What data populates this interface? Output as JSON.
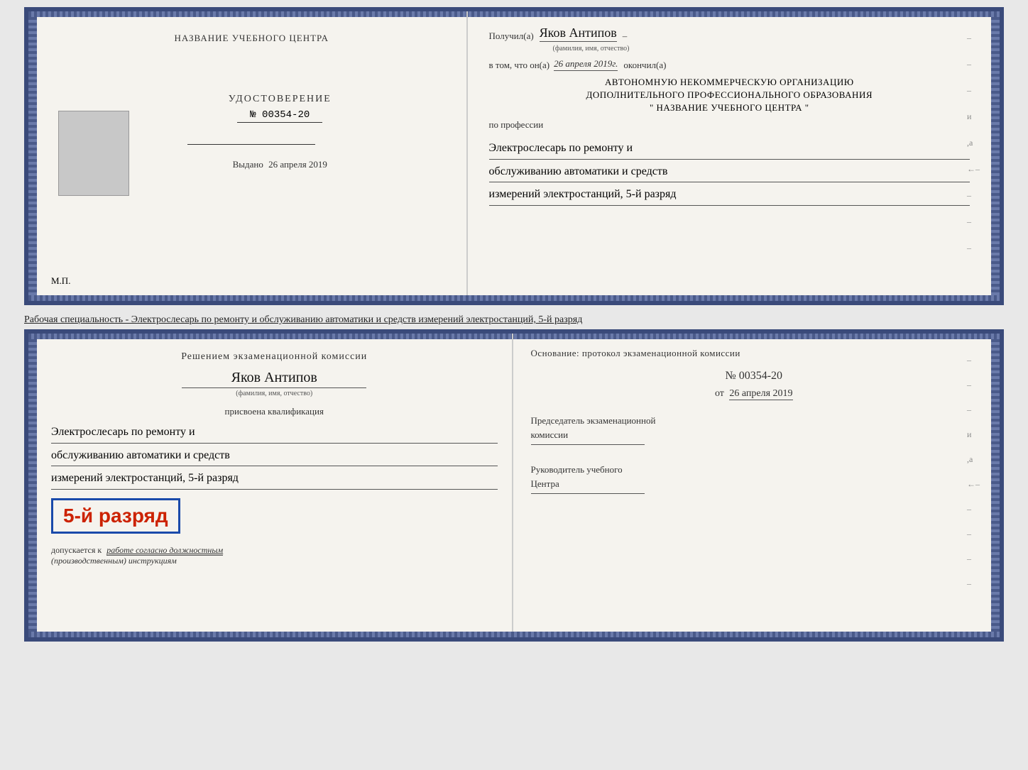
{
  "top_book": {
    "left_page": {
      "training_center_label": "НАЗВАНИЕ УЧЕБНОГО ЦЕНТРА",
      "doc_title": "УДОСТОВЕРЕНИЕ",
      "doc_number": "№ 00354-20",
      "vydano_label": "Выдано",
      "vydano_date": "26 апреля 2019",
      "mp_label": "М.П."
    },
    "right_page": {
      "poluchil_label": "Получил(а)",
      "recipient_name": "Яков Антипов",
      "fio_label": "(фамилия, имя, отчество)",
      "vtom_label": "в том, что он(а)",
      "date_text": "26 апреля 2019г.",
      "okonchil_label": "окончил(а)",
      "org_line1": "АВТОНОМНУЮ НЕКОММЕРЧЕСКУЮ ОРГАНИЗАЦИЮ",
      "org_line2": "ДОПОЛНИТЕЛЬНОГО ПРОФЕССИОНАЛЬНОГО ОБРАЗОВАНИЯ",
      "org_quote": "\"  НАЗВАНИЕ УЧЕБНОГО ЦЕНТРА  \"",
      "po_professii": "по профессии",
      "profession_line1": "Электрослесарь по ремонту и",
      "profession_line2": "обслуживанию автоматики и средств",
      "profession_line3": "измерений электростанций, 5-й разряд"
    }
  },
  "specialty_text": "Рабочая специальность - Электрослесарь по ремонту и обслуживанию автоматики и средств измерений электростанций, 5-й разряд",
  "bottom_book": {
    "left_page": {
      "komissia_title": "Решением экзаменационной комиссии",
      "recipient_name": "Яков Антипов",
      "fio_label": "(фамилия, имя, отчество)",
      "prisvoena_text": "присвоена квалификация",
      "qual_line1": "Электрослесарь по ремонту и",
      "qual_line2": "обслуживанию автоматики и средств",
      "qual_line3": "измерений электростанций, 5-й разряд",
      "rank_text": "5-й разряд",
      "dopuskaetsya_label": "допускается к",
      "dopuskaetsya_text": "работе согласно должностным",
      "dopuskaetsya_text2": "(производственным) инструкциям"
    },
    "right_page": {
      "osnov_text": "Основание: протокол экзаменационной  комиссии",
      "protocol_number": "№  00354-20",
      "protocol_date_prefix": "от",
      "protocol_date": "26 апреля 2019",
      "chairman_line1": "Председатель экзаменационной",
      "chairman_line2": "комиссии",
      "rukovoditel_line1": "Руководитель учебного",
      "rukovoditel_line2": "Центра"
    }
  }
}
